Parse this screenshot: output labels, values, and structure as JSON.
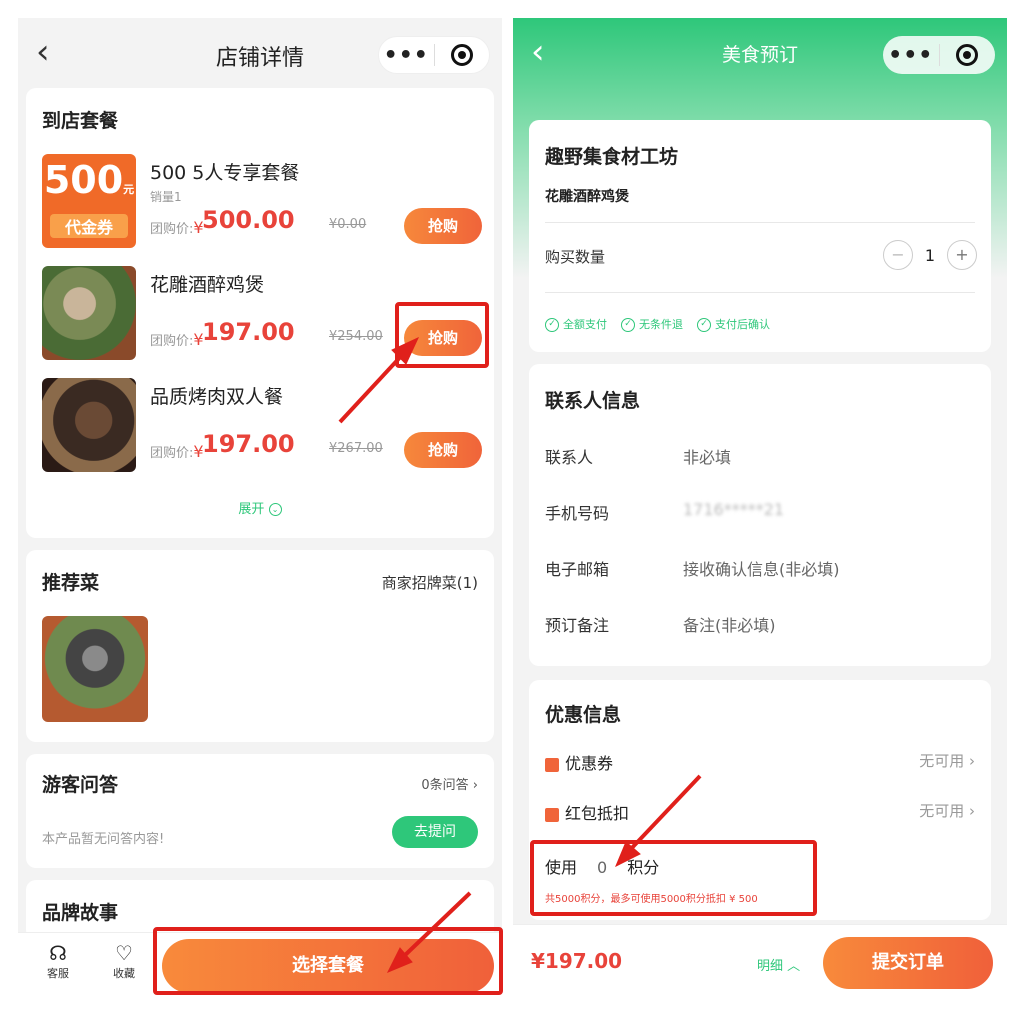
{
  "left": {
    "nav": {
      "back": "‹",
      "title": "店铺详情",
      "more": "•••"
    },
    "packages": {
      "title": "到店套餐",
      "items": [
        {
          "voucher_big": "500",
          "voucher_unit": "元",
          "voucher_small": "代金券",
          "name": "500 5人专享套餐",
          "sold": "销量1",
          "price_label": "团购价:",
          "currency": "¥",
          "price": "500.00",
          "orig": "¥0.00",
          "button": "抢购"
        },
        {
          "name": "花雕酒醉鸡煲",
          "price_label": "团购价:",
          "currency": "¥",
          "price": "197.00",
          "orig": "¥254.00",
          "button": "抢购"
        },
        {
          "name": "品质烤肉双人餐",
          "price_label": "团购价:",
          "currency": "¥",
          "price": "197.00",
          "orig": "¥267.00",
          "button": "抢购"
        }
      ],
      "expand": "展开"
    },
    "recommend": {
      "title": "推荐菜",
      "link": "商家招牌菜(1)"
    },
    "qa": {
      "title": "游客问答",
      "count": "0条问答",
      "empty": "本产品暂无问答内容!",
      "ask": "去提问"
    },
    "brand": {
      "title": "品牌故事"
    },
    "bottom": {
      "service": "客服",
      "favorite": "收藏",
      "select": "选择套餐"
    }
  },
  "right": {
    "nav": {
      "back": "‹",
      "title": "美食预订",
      "more": "•••"
    },
    "shop": {
      "name": "趣野集食材工坊",
      "dish": "花雕酒醉鸡煲",
      "qty_label": "购买数量",
      "qty": "1",
      "tags": [
        "全额支付",
        "无条件退",
        "支付后确认"
      ]
    },
    "contact": {
      "title": "联系人信息",
      "rows": [
        {
          "label": "联系人",
          "value": "非必填"
        },
        {
          "label": "手机号码",
          "value": "1716*****21"
        },
        {
          "label": "电子邮箱",
          "value": "接收确认信息(非必填)"
        },
        {
          "label": "预订备注",
          "value": "备注(非必填)"
        }
      ]
    },
    "discount": {
      "title": "优惠信息",
      "coupon": "优惠券",
      "coupon_value": "无可用",
      "redpack": "红包抵扣",
      "redpack_value": "无可用",
      "use_label": "使用",
      "use_points": "0",
      "points_unit": "积分",
      "points_note_prefix": "共5000积分，最多可使用",
      "points_note_highlight": "5000积分抵扣 ¥ 500"
    },
    "bottom": {
      "total": "¥197.00",
      "detail": "明细",
      "submit": "提交订单"
    }
  },
  "colors": {
    "accent_orange": "#f0643a",
    "price_red": "#e8433a",
    "green": "#2ec77a",
    "annotation_red": "#e0201b"
  }
}
